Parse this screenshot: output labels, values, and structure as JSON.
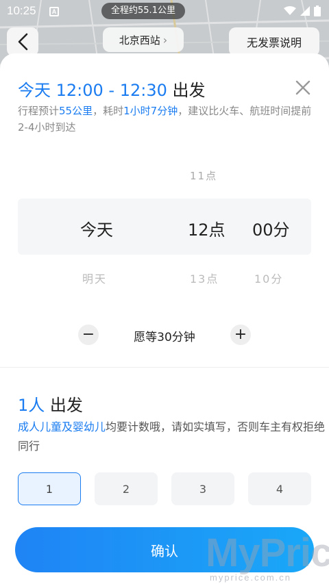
{
  "status_bar": {
    "time": "10:25",
    "route_summary": "全程约55.1公里"
  },
  "nav": {
    "station": "北京西站",
    "no_fare_label": "无发票说明"
  },
  "departure": {
    "title_time": "今天 12:00 - 12:30",
    "title_suffix": "出发",
    "desc_prefix": "行程预计",
    "distance": "55公里",
    "desc_mid": "，耗时",
    "duration": "1小时7分钟",
    "desc_suffix": "，建议比火车、航班时间提前2-4小时到达"
  },
  "picker": {
    "hour_above": "11点",
    "day_selected": "今天",
    "hour_selected": "12点",
    "minute_selected": "00分",
    "day_below": "明天",
    "hour_below": "13点",
    "minute_below": "10分"
  },
  "wait": {
    "minus": "−",
    "label": "愿等30分钟",
    "plus": "+"
  },
  "people": {
    "count_text": "1人",
    "title_suffix": "出发",
    "desc_highlight": "成人儿童及婴幼儿",
    "desc_rest": "均要计数哦，请如实填写，否则车主有权拒绝同行",
    "options": [
      "1",
      "2",
      "3",
      "4"
    ],
    "selected": "1"
  },
  "confirm_label": "确认",
  "watermark": {
    "brand": "MyPrice",
    "url": "myprice.com.cn"
  },
  "colors": {
    "accent": "#1a7cf0",
    "confirm_gradient_start": "#1f84f5",
    "confirm_gradient_end": "#1aa8f8"
  }
}
